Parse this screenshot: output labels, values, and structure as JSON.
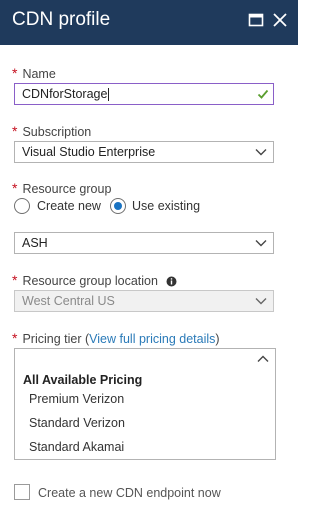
{
  "panel": {
    "title": "CDN profile",
    "maximize_icon": "maximize-icon",
    "close_icon": "close-icon",
    "colors": {
      "titlebar": "#1f3a5c",
      "required": "#c50f1f",
      "link": "#2a7ab8",
      "radio_selected": "#1a73c2",
      "valid_check": "#5a9e2f"
    }
  },
  "form": {
    "name": {
      "required": "*",
      "label": "Name",
      "value": "CDNforStorage",
      "valid_icon": "checkmark-icon"
    },
    "subscription": {
      "required": "*",
      "label": "Subscription",
      "value": "Visual Studio Enterprise"
    },
    "resource_group": {
      "required": "*",
      "label": "Resource group",
      "options": [
        {
          "label": "Create new",
          "selected": false
        },
        {
          "label": "Use existing",
          "selected": true
        }
      ],
      "value": "ASH"
    },
    "resource_group_location": {
      "required": "*",
      "label": "Resource group location",
      "value": "West Central US",
      "info_icon": "info-icon"
    },
    "pricing_tier": {
      "required": "*",
      "label": "Pricing tier",
      "link_open": "(",
      "link_text": "View full pricing details",
      "link_close": ")",
      "value": "",
      "dropdown": {
        "header": "All Available Pricing",
        "items": [
          "Premium Verizon",
          "Standard Verizon",
          "Standard Akamai"
        ]
      }
    },
    "create_endpoint": {
      "label": "Create a new CDN endpoint now",
      "checked": false
    }
  }
}
